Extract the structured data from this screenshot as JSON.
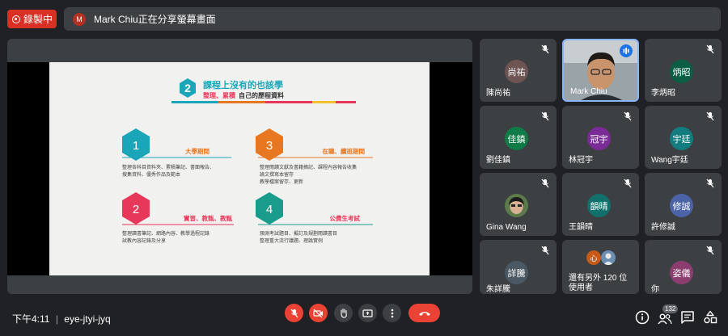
{
  "recording": {
    "label": "錄製中"
  },
  "banner": {
    "avatar_letter": "M",
    "text": "Mark Chiu正在分享螢幕畫面"
  },
  "slide": {
    "number": "2",
    "title": "課程上沒有的也該學",
    "subtitle_red": "整理、累積",
    "subtitle_rest": "自己的歷程資料",
    "sections": [
      {
        "num": "1",
        "heading": "大學期間",
        "body": [
          "整理各科目資料夾、累積筆記、書面報告、",
          "搜集資料、優秀作品及範本"
        ],
        "color": "#1aa6b8"
      },
      {
        "num": "3",
        "heading": "在職、續班期間",
        "body": [
          "整理閱讀文獻及書籍摘記、課程內容報告收集",
          "論文撰寫本留存",
          "教學檔案留存、更新"
        ],
        "color": "#e87722"
      },
      {
        "num": "2",
        "heading": "實習、教甄、教甄",
        "body": [
          "整理讀書筆記、網路內容、教學過程記錄",
          "試教內容記錄及分享"
        ],
        "color": "#e8385a"
      },
      {
        "num": "4",
        "heading": "公費生考試",
        "body": [
          "預測考試題目、擬訂及規劃閱讀書目",
          "整理重大流行議題、理論實例"
        ],
        "color": "#1a9c8c"
      }
    ]
  },
  "participants": [
    {
      "avatar": "尚祐",
      "name": "陳尚祐",
      "color": "#6e5452"
    },
    {
      "avatar": "",
      "name": "Mark Chiu",
      "color": "#8a8f95",
      "video": true
    },
    {
      "avatar": "炳昭",
      "name": "李炳昭",
      "color": "#0b5d44"
    },
    {
      "avatar": "佳鎮",
      "name": "劉佳鎮",
      "color": "#0f7c48"
    },
    {
      "avatar": "冠宇",
      "name": "林冠宇",
      "color": "#7a2b95"
    },
    {
      "avatar": "宇廷",
      "name": "Wang宇廷",
      "color": "#127c7e"
    },
    {
      "avatar": "",
      "name": "Gina Wang",
      "color": "#4b5a42",
      "photo": true
    },
    {
      "avatar": "韻晴",
      "name": "王韻晴",
      "color": "#11706b"
    },
    {
      "avatar": "修誠",
      "name": "許修誠",
      "color": "#4b63a7"
    },
    {
      "avatar": "詳騰",
      "name": "朱詳騰",
      "color": "#4a5863"
    },
    {
      "avatar": "心",
      "name": "還有另外 120 位使用者",
      "color": "#c75a17",
      "others": true
    },
    {
      "avatar": "姿儀",
      "name": "你",
      "color": "#8c3d6f"
    }
  ],
  "footer": {
    "time": "下午4:11",
    "meeting_code": "eye-jtyi-jyq",
    "people_count": "132"
  },
  "colors": {
    "end_call": "#ea4335",
    "muted_red": "#ea4335",
    "speaking_blue": "#1a73e8"
  }
}
